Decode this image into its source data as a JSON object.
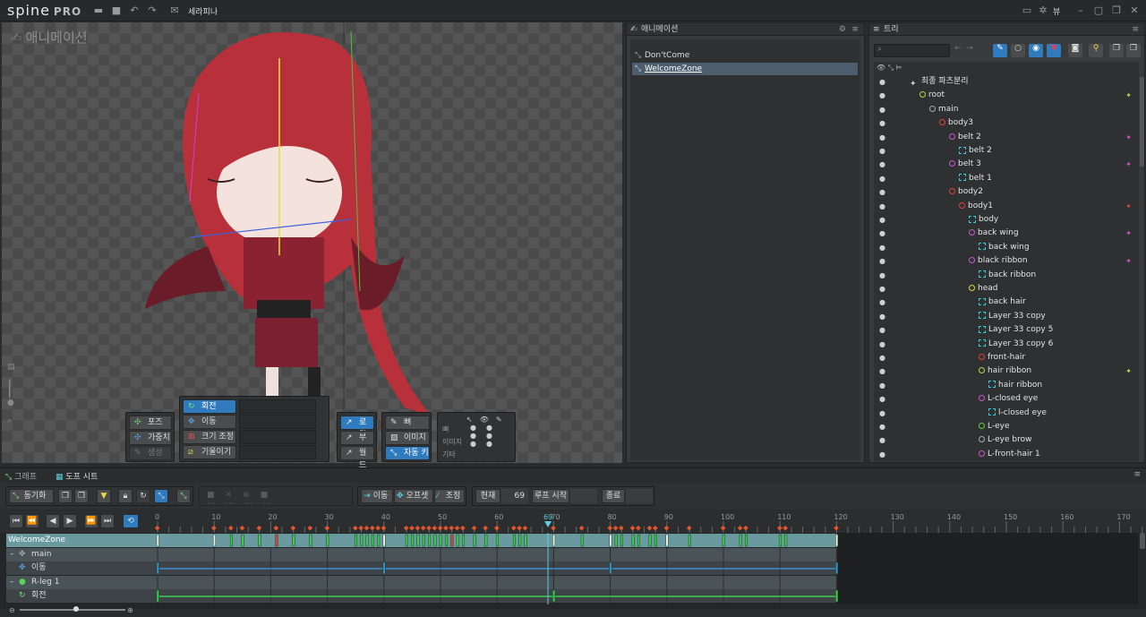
{
  "app": {
    "logo": "spine",
    "edition": "PRO",
    "project": "세라피나",
    "view_menu": "뷰"
  },
  "viewport": {
    "title": "애니메이션"
  },
  "tools": {
    "left": [
      {
        "label": "포즈",
        "on": false
      },
      {
        "label": "가중치",
        "on": false
      },
      {
        "label": "생성",
        "on": false,
        "disabled": true
      }
    ],
    "transform": [
      {
        "label": "회전",
        "on": true
      },
      {
        "label": "이동",
        "on": false
      },
      {
        "label": "크기 조정",
        "on": false
      },
      {
        "label": "기울이기",
        "on": false
      }
    ],
    "axes": [
      {
        "label": "로컬",
        "on": true
      },
      {
        "label": "부모",
        "on": false
      },
      {
        "label": "월드",
        "on": false
      }
    ],
    "compensate": [
      {
        "label": "뼈",
        "on": false
      },
      {
        "label": "이미지",
        "on": false
      },
      {
        "label": "자동 키",
        "on": true
      }
    ],
    "visibility": {
      "rows": [
        "뼈",
        "이미지",
        "기타"
      ]
    }
  },
  "animations_panel": {
    "title": "애니메이션",
    "items": [
      "Don'tCome",
      "WelcomeZone"
    ],
    "selected": 1
  },
  "tree_panel": {
    "title": "트리",
    "rows": [
      {
        "label": "최종 파츠분리",
        "depth": 0,
        "type": "skeleton",
        "color": "#cccccc"
      },
      {
        "label": "root",
        "depth": 1,
        "type": "bone",
        "color": "#b7d54a",
        "right": "✦"
      },
      {
        "label": "main",
        "depth": 2,
        "type": "bone",
        "color": "#aaaaaa"
      },
      {
        "label": "body3",
        "depth": 3,
        "type": "bone",
        "color": "#e0443c"
      },
      {
        "label": "belt 2",
        "depth": 4,
        "type": "bone",
        "color": "#cc55cc",
        "right": "✦"
      },
      {
        "label": "belt 2",
        "depth": 5,
        "type": "image",
        "color": "#3cc9e0"
      },
      {
        "label": "belt 3",
        "depth": 4,
        "type": "bone",
        "color": "#cc55cc",
        "right": "✦"
      },
      {
        "label": "belt 1",
        "depth": 5,
        "type": "image",
        "color": "#3cc9e0"
      },
      {
        "label": "body2",
        "depth": 4,
        "type": "bone",
        "color": "#e0443c"
      },
      {
        "label": "body1",
        "depth": 5,
        "type": "bone",
        "color": "#e0443c",
        "right": "✦"
      },
      {
        "label": "body",
        "depth": 6,
        "type": "image",
        "color": "#3cc9e0"
      },
      {
        "label": "back wing",
        "depth": 6,
        "type": "bone",
        "color": "#cc55cc",
        "right": "✦"
      },
      {
        "label": "back wing",
        "depth": 7,
        "type": "image",
        "color": "#3cc9e0"
      },
      {
        "label": "black ribbon",
        "depth": 6,
        "type": "bone",
        "color": "#cc55cc",
        "right": "✦"
      },
      {
        "label": "back ribbon",
        "depth": 7,
        "type": "image",
        "color": "#3cc9e0"
      },
      {
        "label": "head",
        "depth": 6,
        "type": "bone",
        "color": "#e8d84a"
      },
      {
        "label": "back hair",
        "depth": 7,
        "type": "image",
        "color": "#3cc9e0"
      },
      {
        "label": "Layer 33 copy",
        "depth": 7,
        "type": "image",
        "color": "#3cc9e0"
      },
      {
        "label": "Layer 33 copy 5",
        "depth": 7,
        "type": "image",
        "color": "#3cc9e0"
      },
      {
        "label": "Layer 33 copy 6",
        "depth": 7,
        "type": "image",
        "color": "#3cc9e0"
      },
      {
        "label": "front-hair",
        "depth": 7,
        "type": "bone",
        "color": "#e0443c"
      },
      {
        "label": "hair ribbon",
        "depth": 7,
        "type": "bone",
        "color": "#b7d54a",
        "right": "✦"
      },
      {
        "label": "hair ribbon",
        "depth": 8,
        "type": "image",
        "color": "#3cc9e0"
      },
      {
        "label": "L-closed eye",
        "depth": 7,
        "type": "bone",
        "color": "#cc55cc"
      },
      {
        "label": "l-closed eye",
        "depth": 8,
        "type": "image",
        "color": "#3cc9e0"
      },
      {
        "label": "L-eye",
        "depth": 7,
        "type": "bone",
        "color": "#66cc44"
      },
      {
        "label": "L-eye brow",
        "depth": 7,
        "type": "bone",
        "color": "#aaaaaa"
      },
      {
        "label": "L-front-hair 1",
        "depth": 7,
        "type": "bone",
        "color": "#cc55cc"
      }
    ]
  },
  "bottom_tabs": [
    "그래프",
    "도프 시트"
  ],
  "dopesheet_toolbar": {
    "sync": "동기화",
    "move": "이동",
    "offset": "오프셋",
    "adjust": "조정",
    "current_label": "현재",
    "current": "69",
    "loop_start": "루프 시작",
    "end": "종료"
  },
  "ruler": {
    "ticks": [
      0,
      10,
      20,
      30,
      40,
      50,
      60,
      69,
      70,
      80,
      90,
      100,
      110,
      120,
      130,
      140,
      150,
      160,
      170
    ],
    "playhead": 69,
    "end": 120
  },
  "dopesheet_rows": [
    {
      "label": "WelcomeZone",
      "kind": "anim"
    },
    {
      "label": "main",
      "kind": "bone"
    },
    {
      "label": "이동",
      "kind": "timeline"
    },
    {
      "label": "R-leg 1",
      "kind": "bone"
    },
    {
      "label": "회전",
      "kind": "timeline"
    }
  ],
  "keys": {
    "summary": [
      0,
      10,
      13,
      15,
      18,
      21,
      24,
      27,
      30,
      35,
      36,
      37,
      38,
      39,
      40,
      44,
      45,
      46,
      47,
      48,
      49,
      50,
      51,
      52,
      53,
      54,
      56,
      58,
      60,
      63,
      64,
      65,
      70,
      75,
      80,
      81,
      82,
      84,
      85,
      87,
      88,
      90,
      94,
      100,
      103,
      104,
      110,
      111,
      120
    ],
    "move": [
      0,
      40,
      80,
      120
    ],
    "rotate": [
      0,
      70,
      120
    ]
  }
}
